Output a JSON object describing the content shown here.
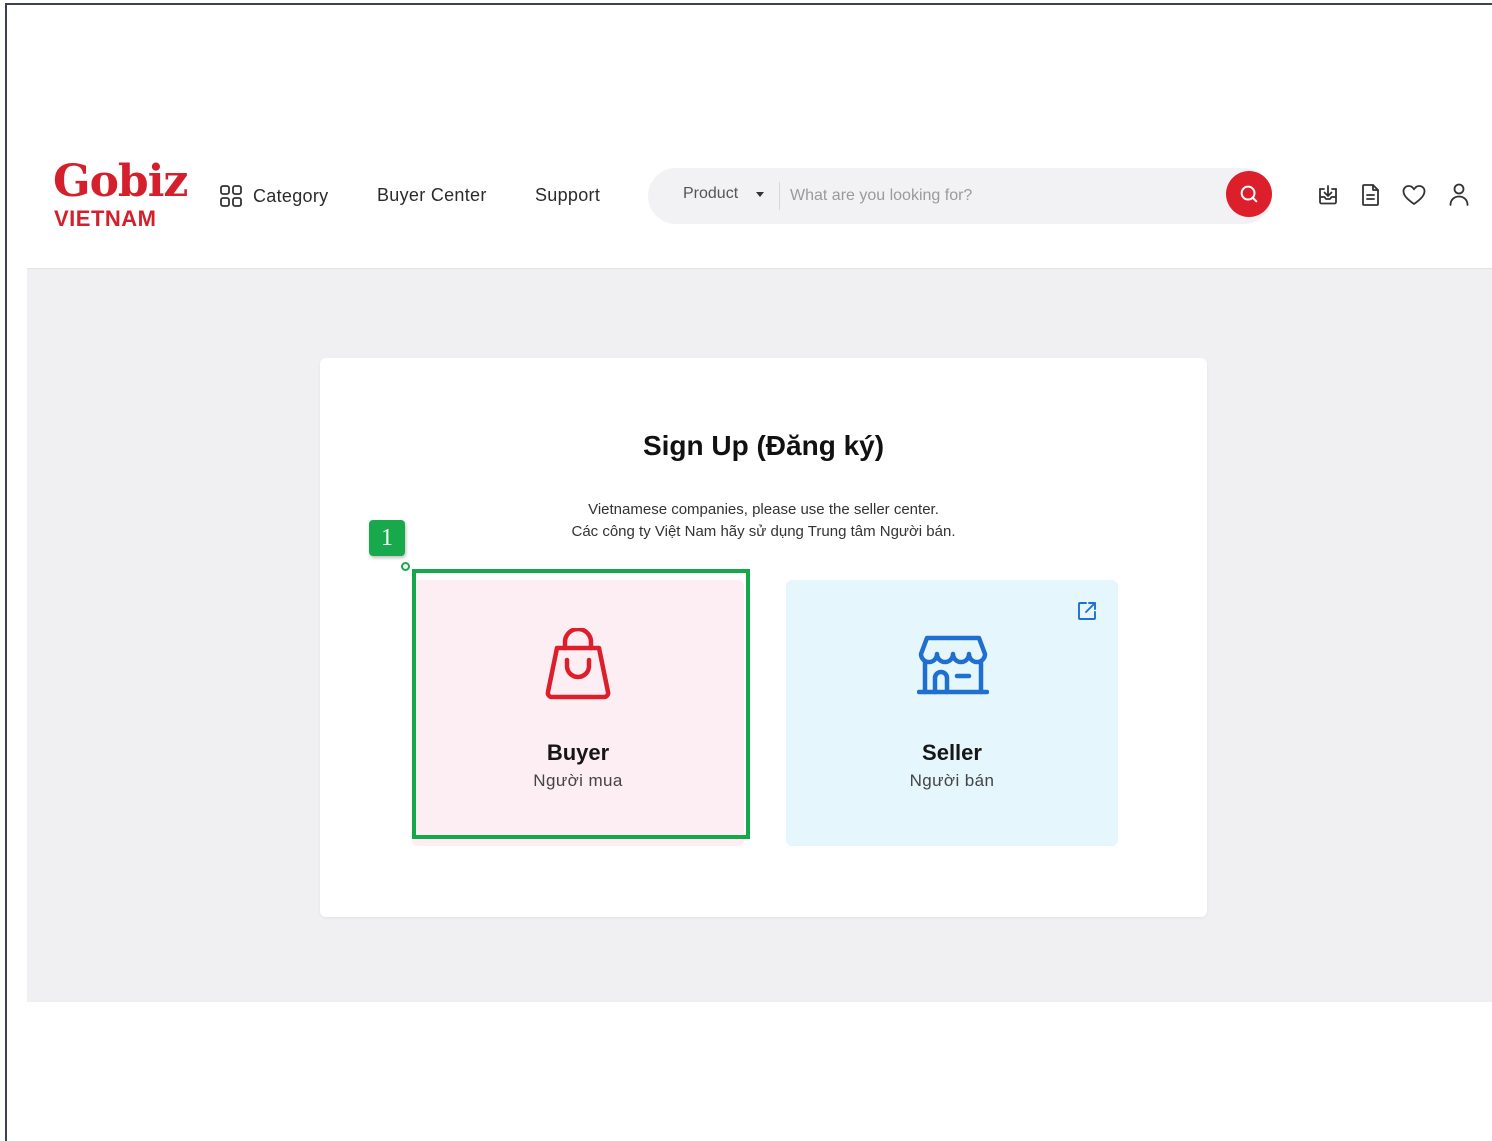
{
  "brand": {
    "name_top": "Gobiz",
    "name_bottom": "VIETNAM",
    "color": "#d4202c"
  },
  "nav": {
    "category": "Category",
    "buyer_center": "Buyer Center",
    "support": "Support"
  },
  "search": {
    "type_selected": "Product",
    "placeholder": "What are you looking for?",
    "button_color": "#dd1f2b"
  },
  "header_icons": [
    "download-box-icon",
    "document-icon",
    "heart-icon",
    "user-icon"
  ],
  "signup": {
    "title": "Sign Up (Đăng ký)",
    "subtitle_line1": "Vietnamese companies, please use the seller center.",
    "subtitle_line2": "Các công ty Việt Nam hãy sử dụng Trung tâm Người bán.",
    "buyer": {
      "title": "Buyer",
      "subtitle": "Người mua",
      "icon": "shopping-bag-icon",
      "bg": "#fdeef4"
    },
    "seller": {
      "title": "Seller",
      "subtitle": "Người bán",
      "icon": "storefront-icon",
      "bg": "#e5f6fd"
    }
  },
  "annotation": {
    "label": "1",
    "color": "#14a84a"
  }
}
